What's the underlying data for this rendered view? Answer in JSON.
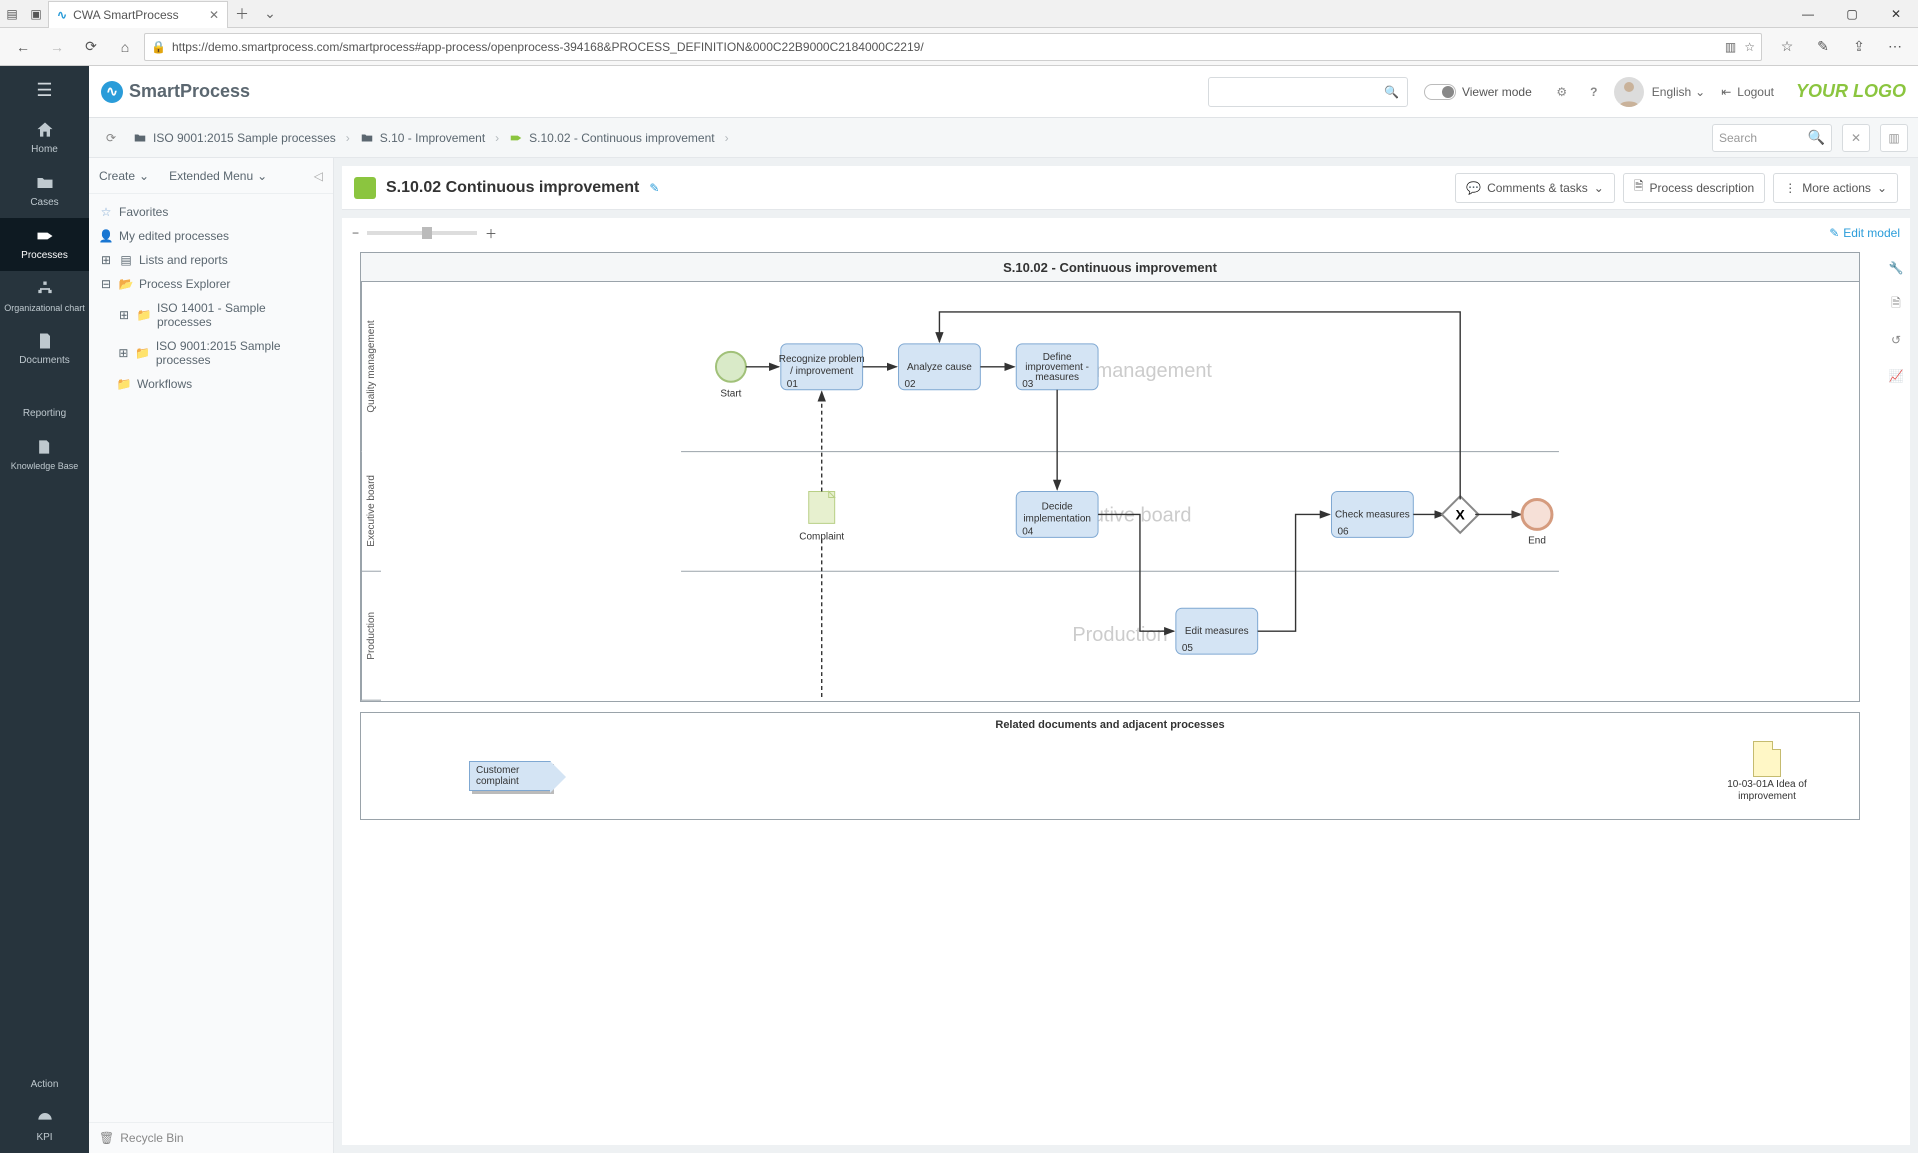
{
  "browser": {
    "tab_title": "CWA SmartProcess",
    "url": "https://demo.smartprocess.com/smartprocess#app-process/openprocess-394168&PROCESS_DEFINITION&000C22B9000C2184000C2219/"
  },
  "app": {
    "logo": "SmartProcess",
    "viewer_mode": "Viewer mode",
    "language": "English",
    "logout": "Logout",
    "your_logo": "YOUR LOGO",
    "search_placeholder": "Search"
  },
  "rail": {
    "items": [
      {
        "label": "Home"
      },
      {
        "label": "Cases"
      },
      {
        "label": "Processes"
      },
      {
        "label": "Organizational chart"
      },
      {
        "label": "Documents"
      },
      {
        "label": "Reporting"
      },
      {
        "label": "Knowledge Base"
      }
    ],
    "bottom": [
      {
        "label": "Action"
      },
      {
        "label": "KPI"
      }
    ]
  },
  "breadcrumbs": [
    "ISO 9001:2015 Sample processes",
    "S.10 - Improvement",
    "S.10.02 - Continuous improvement"
  ],
  "sidebar": {
    "create": "Create",
    "extended_menu": "Extended Menu",
    "favorites": "Favorites",
    "my_edited": "My edited processes",
    "lists": "Lists and reports",
    "explorer": "Process Explorer",
    "tree": [
      "ISO 14001 - Sample processes",
      "ISO 9001:2015 Sample processes",
      "Workflows"
    ],
    "recycle": "Recycle Bin"
  },
  "page": {
    "title": "S.10.02 Continuous improvement",
    "comments": "Comments & tasks",
    "description": "Process description",
    "more_actions": "More actions",
    "edit_model": "Edit model"
  },
  "diagram": {
    "title": "S.10.02 - Continuous improvement",
    "lanes": [
      "Quality management",
      "Executive board",
      "Production"
    ],
    "start": "Start",
    "end": "End",
    "complaint": "Complaint",
    "tasks": [
      {
        "id": "01",
        "label": "Recognize problem / improvement"
      },
      {
        "id": "02",
        "label": "Analyze cause"
      },
      {
        "id": "03",
        "label": "Define improvement - measures"
      },
      {
        "id": "04",
        "label": "Decide implementation"
      },
      {
        "id": "05",
        "label": "Edit measures"
      },
      {
        "id": "06",
        "label": "Check measures"
      }
    ],
    "related_title": "Related documents and adjacent processes",
    "related_process": "Customer complaint",
    "related_doc": "10-03-01A Idea of improvement"
  }
}
